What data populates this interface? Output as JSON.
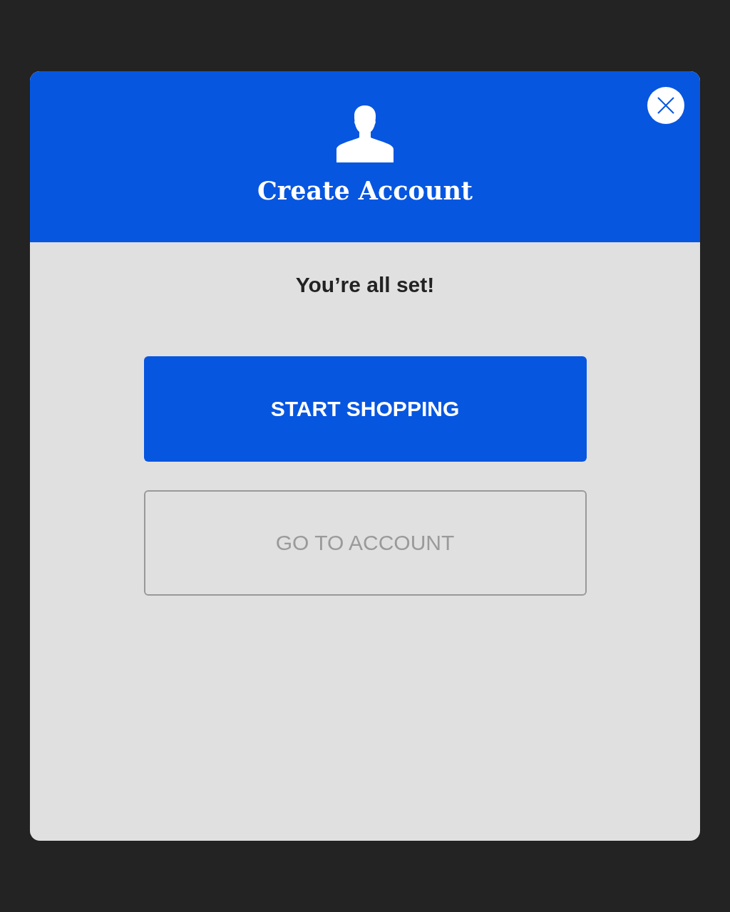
{
  "dialog": {
    "title": "Create Account",
    "message": "You’re all set!",
    "buttons": [
      {
        "label": "START SHOPPING",
        "kind": "primary"
      },
      {
        "label": "GO TO ACCOUNT",
        "kind": "secondary"
      }
    ]
  }
}
